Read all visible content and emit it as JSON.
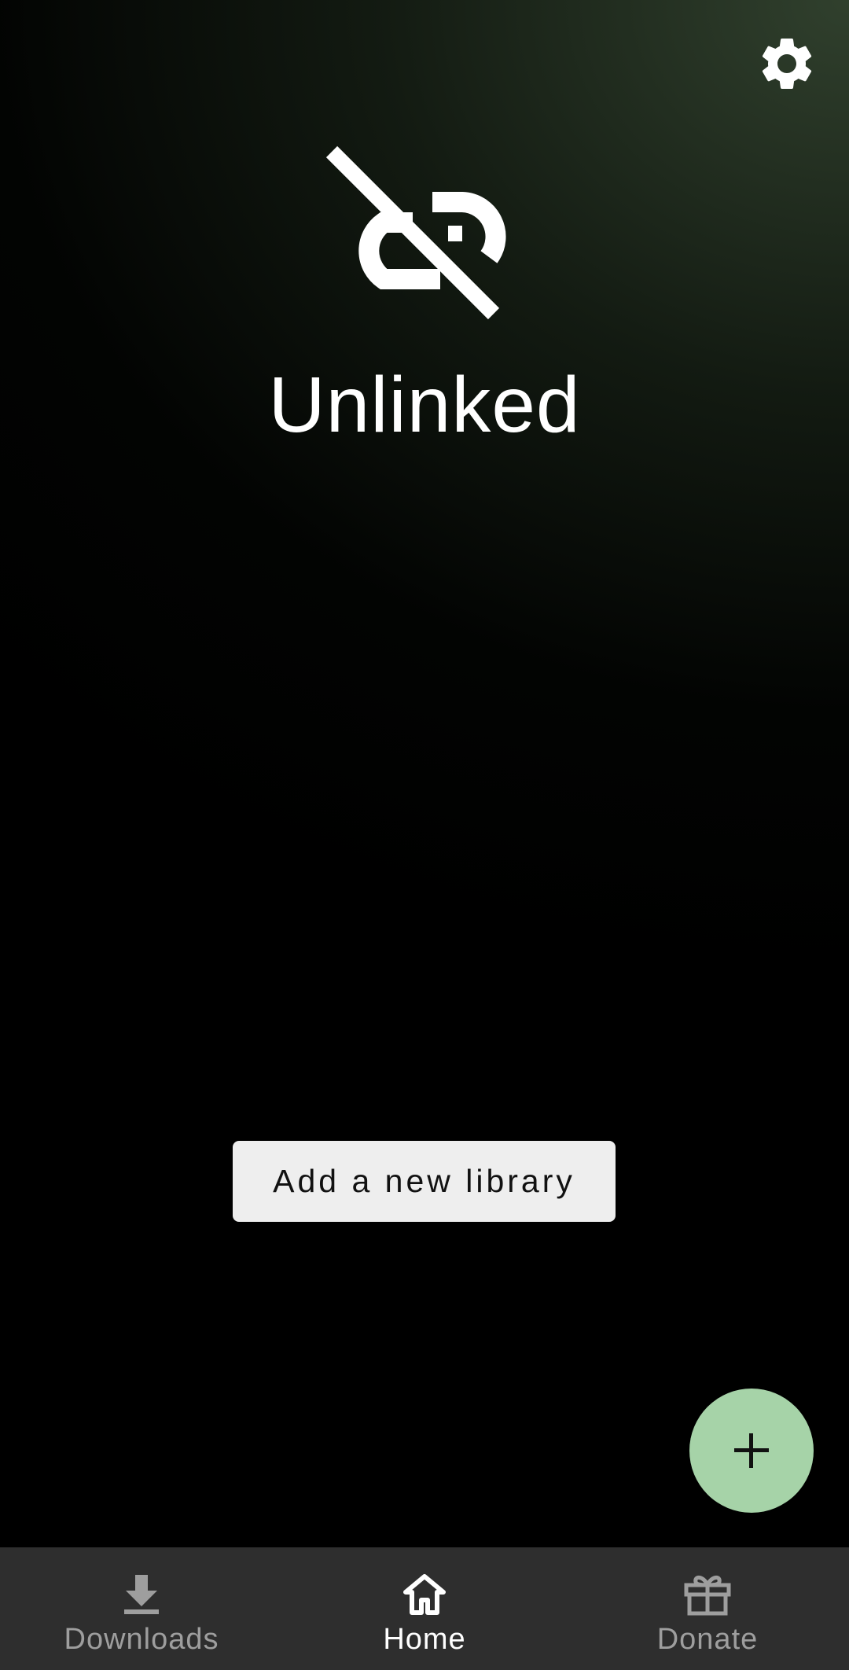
{
  "header": {
    "settings_icon": "gear-icon"
  },
  "hero": {
    "icon": "link-off-icon",
    "title": "Unlinked"
  },
  "actions": {
    "add_library_label": "Add a new library",
    "fab_icon": "plus-icon",
    "fab_color": "#a6d3a8"
  },
  "bottom_nav": {
    "items": [
      {
        "label": "Downloads",
        "icon": "download-icon",
        "active": false
      },
      {
        "label": "Home",
        "icon": "home-icon",
        "active": true
      },
      {
        "label": "Donate",
        "icon": "gift-icon",
        "active": false
      }
    ],
    "background": "#2e2e2e",
    "active_color": "#ffffff",
    "inactive_color": "#9e9e9e"
  }
}
